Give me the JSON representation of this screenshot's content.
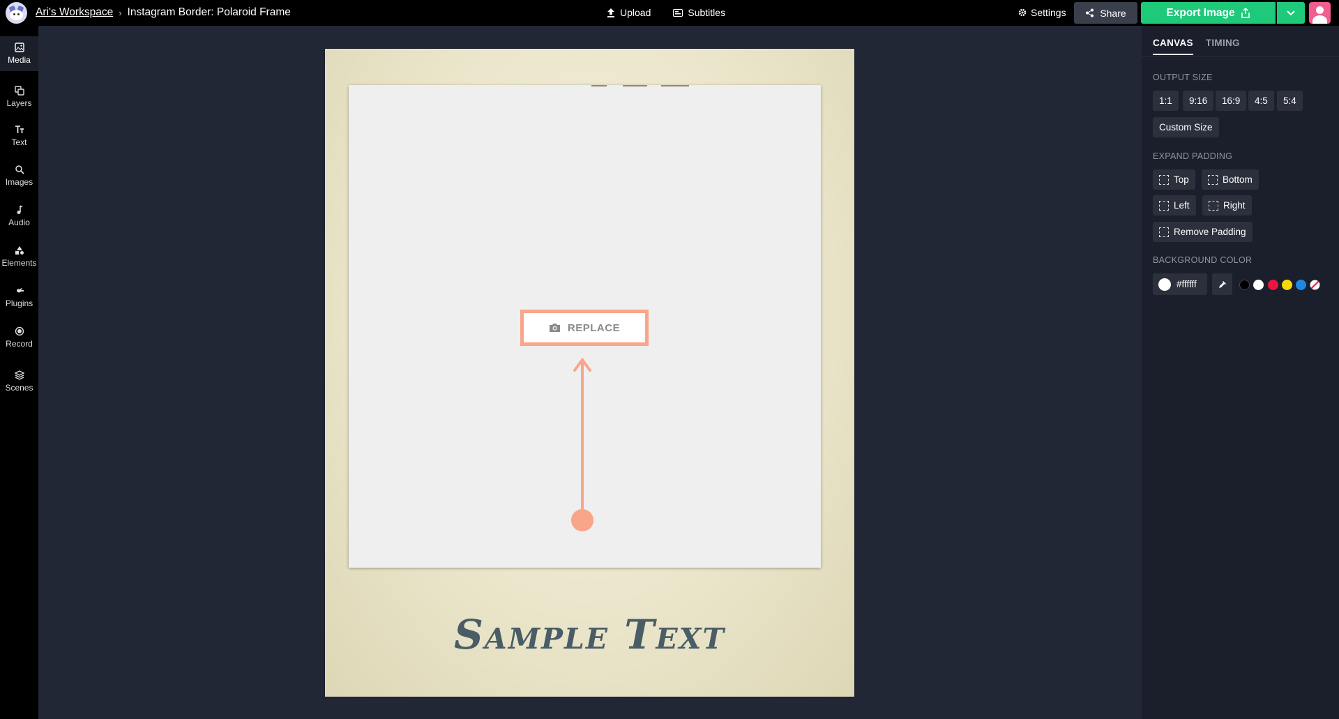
{
  "topbar": {
    "workspace": "Ari's Workspace",
    "project_title": "Instagram Border: Polaroid Frame",
    "upload_label": "Upload",
    "subtitles_label": "Subtitles",
    "settings_label": "Settings",
    "share_label": "Share",
    "export_label": "Export Image"
  },
  "sidebar": {
    "items": [
      {
        "label": "Media",
        "icon": "image-icon"
      },
      {
        "label": "Layers",
        "icon": "layers-icon"
      },
      {
        "label": "Text",
        "icon": "text-icon"
      },
      {
        "label": "Images",
        "icon": "search-icon"
      },
      {
        "label": "Audio",
        "icon": "music-note-icon"
      },
      {
        "label": "Elements",
        "icon": "shapes-icon"
      },
      {
        "label": "Plugins",
        "icon": "plugin-icon"
      },
      {
        "label": "Record",
        "icon": "record-icon"
      },
      {
        "label": "Scenes",
        "icon": "stack-icon"
      }
    ]
  },
  "canvas": {
    "replace_label": "REPLACE",
    "sample_text": "Sample Text",
    "accent_color": "#f8a58a"
  },
  "panel": {
    "tabs": [
      "CANVAS",
      "TIMING"
    ],
    "output_size_label": "OUTPUT SIZE",
    "sizes": [
      "1:1",
      "9:16",
      "16:9",
      "4:5",
      "5:4"
    ],
    "custom_size": "Custom Size",
    "expand_padding_label": "EXPAND PADDING",
    "padding": {
      "top": "Top",
      "bottom": "Bottom",
      "left": "Left",
      "right": "Right",
      "remove": "Remove Padding"
    },
    "background_color_label": "BACKGROUND COLOR",
    "background_color": "#ffffff",
    "swatches": [
      "#000000",
      "#ffffff",
      "#e8173f",
      "#f5d90c",
      "#1e88e5",
      "transparent"
    ]
  }
}
